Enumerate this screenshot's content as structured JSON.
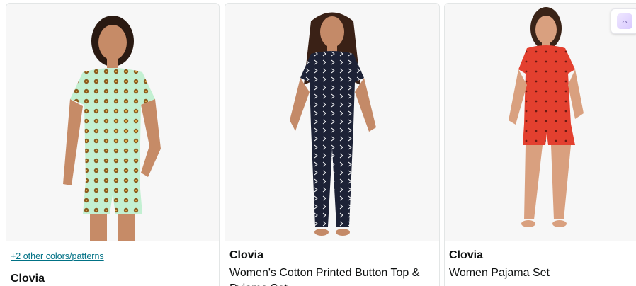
{
  "products": [
    {
      "colors_link": "+2 other colors/patterns",
      "brand": "Clovia",
      "title": "",
      "image_desc_colors": {
        "top": "#bff0cf",
        "pattern": "#8a5a1e"
      }
    },
    {
      "colors_link": "",
      "brand": "Clovia",
      "title": "Women's Cotton Printed Button Top & Pyjama Set",
      "image_desc_colors": {
        "top": "#1d2236",
        "pattern": "#ffffff"
      }
    },
    {
      "colors_link": "",
      "brand": "Clovia",
      "title": "Women Pajama Set",
      "image_desc_colors": {
        "top": "#e0402f",
        "pattern": "#7a1a12"
      }
    }
  ],
  "widget": {
    "glyph": "›‹",
    "icon": "assistant-widget-icon"
  }
}
